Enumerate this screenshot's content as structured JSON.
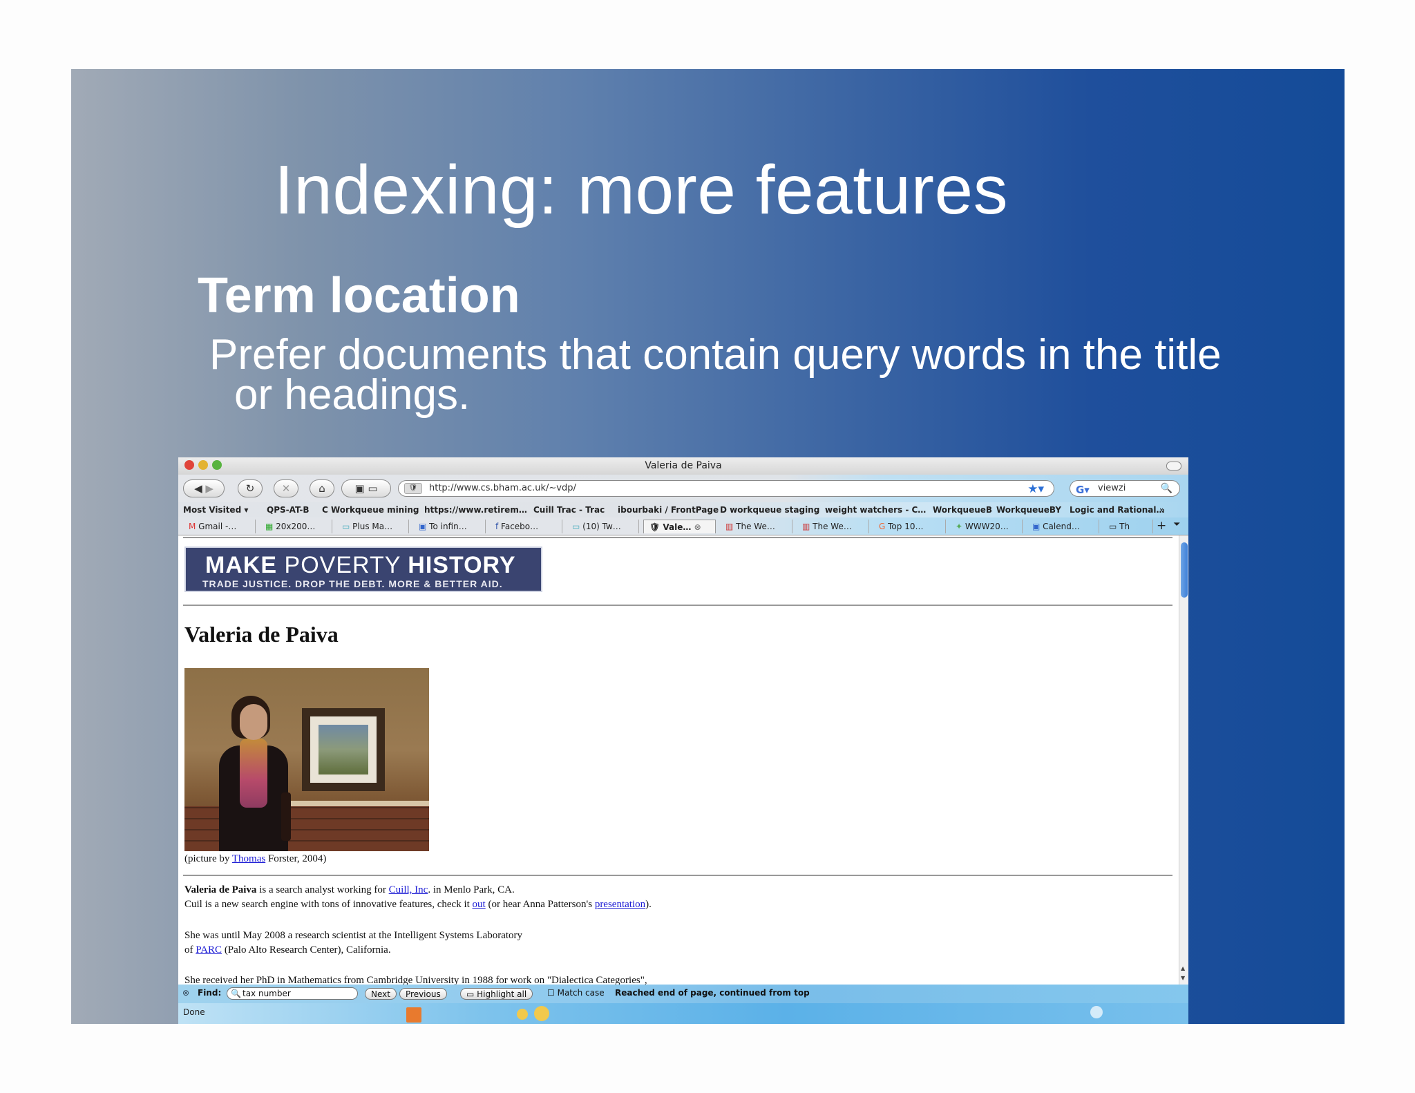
{
  "slide": {
    "title": "Indexing: more features",
    "subtitle": "Term location",
    "body_line1": "Prefer documents that contain query words in the title",
    "body_line2": "or headings."
  },
  "browser": {
    "window_title": "Valeria de Paiva",
    "url": "http://www.cs.bham.ac.uk/~vdp/",
    "search_value": "viewzi",
    "bookmarks": [
      "Most Visited ▾",
      "QPS-AT-B",
      "C Workqueue mining",
      "https://www.retirem…",
      "Cuill Trac - Trac",
      "ibourbaki / FrontPage",
      "D workqueue staging",
      "weight watchers - C…",
      "WorkqueueB",
      "WorkqueueBY",
      "Logic and Rational…"
    ],
    "tabs": [
      "Gmail -…",
      "20x200…",
      "Plus Ma…",
      "To infin…",
      "Facebo…",
      "(10) Tw…",
      "Vale…",
      "The We…",
      "The We…",
      "Top 10…",
      "WWW20…",
      "Calend…",
      "Th"
    ],
    "icons": [
      "back-icon",
      "forward-icon",
      "reload-icon",
      "stop-icon",
      "home-icon",
      "bookmark-star-icon",
      "search-icon",
      "close-tab-icon",
      "new-tab-icon",
      "rss-icon"
    ]
  },
  "page": {
    "banner_line1_bold1": "MAKE",
    "banner_line1_thin": " POVERTY ",
    "banner_line1_bold2": "HISTORY",
    "banner_line2": "TRADE JUSTICE.   DROP THE DEBT.   MORE & BETTER AID.",
    "heading": "Valeria de Paiva",
    "caption_pre": "(picture by ",
    "caption_link": "Thomas",
    "caption_post": " Forster, 2004)",
    "p1_bold": "Valeria de Paiva",
    "p1_text": " is a  search analyst working for ",
    "p1_link": "Cuill, Inc",
    "p1_end": ". in Menlo Park, CA.",
    "p2_text": "Cuil is a new search engine with tons of innovative features, check it ",
    "p2_link1": "out",
    "p2_mid": " (or hear Anna Patterson's ",
    "p2_link2": "presentation",
    "p2_end": ").",
    "p3_line1": "She was  until May 2008 a research scientist at the Intelligent Systems Laboratory",
    "p3_pre": "of ",
    "p3_link": "PARC",
    "p3_post": " (Palo Alto Research Center), California.",
    "p4": "She received her PhD in Mathematics from Cambridge University in 1988 for work on \"Dialectica Categories\","
  },
  "findbar": {
    "label": "Find:",
    "value": "tax number",
    "next": "Next",
    "previous": "Previous",
    "highlight": "Highlight all",
    "match_case": "Match case",
    "message": "Reached end of page, continued from top"
  },
  "status": {
    "text": "Done"
  },
  "colors": {
    "slide_left": "#a1aab6",
    "slide_right": "#144b98",
    "banner": "#3a4470",
    "link": "#1a1ad4"
  }
}
